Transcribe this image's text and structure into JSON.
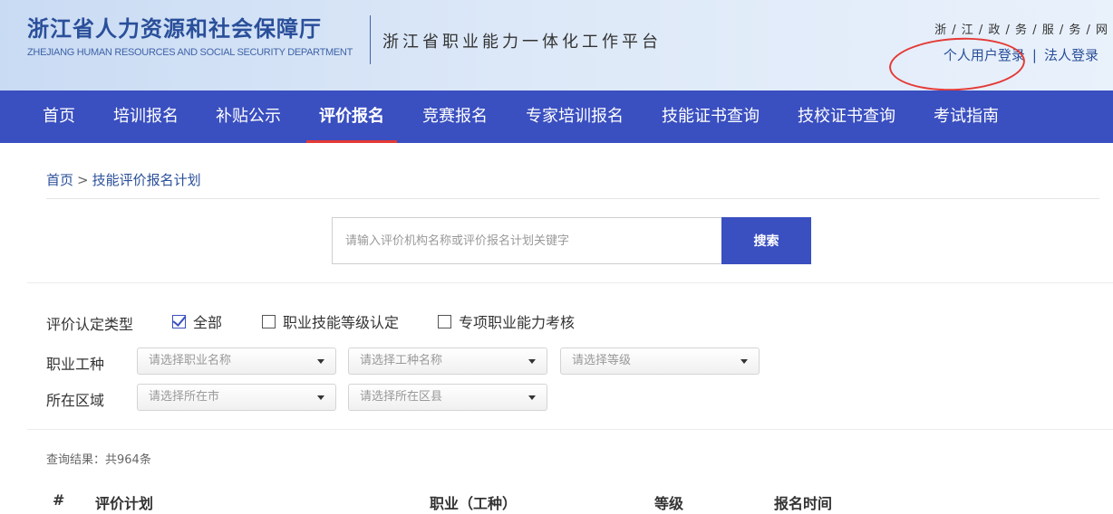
{
  "header": {
    "logo_cn": "浙江省人力资源和社会保障厅",
    "logo_en": "ZHEJIANG HUMAN RESOURCES AND SOCIAL SECURITY DEPARTMENT",
    "platform_name": "浙江省职业能力一体化工作平台",
    "gov_links": "浙 / 江 / 政 / 务 / 服 / 务 / 网",
    "personal_login": "个人用户登录",
    "separator": "|",
    "legal_login": "法人登录"
  },
  "nav": {
    "items": [
      "首页",
      "培训报名",
      "补贴公示",
      "评价报名",
      "竞赛报名",
      "专家培训报名",
      "技能证书查询",
      "技校证书查询",
      "考试指南"
    ],
    "active_index": 3
  },
  "breadcrumb": {
    "home": "首页",
    "sep": ">",
    "current": "技能评价报名计划"
  },
  "search": {
    "placeholder": "请输入评价机构名称或评价报名计划关键字",
    "button": "搜索"
  },
  "filters": {
    "type_label": "评价认定类型",
    "types": [
      {
        "label": "全部",
        "checked": true
      },
      {
        "label": "职业技能等级认定",
        "checked": false
      },
      {
        "label": "专项职业能力考核",
        "checked": false
      }
    ],
    "occupation_label": "职业工种",
    "occupation_selects": [
      "请选择职业名称",
      "请选择工种名称",
      "请选择等级"
    ],
    "region_label": "所在区域",
    "region_selects": [
      "请选择所在市",
      "请选择所在区县"
    ]
  },
  "results": {
    "count_text": "查询结果：共964条",
    "columns": [
      "#",
      "评价计划",
      "职业（工种）",
      "等级",
      "报名时间"
    ]
  },
  "colors": {
    "primary": "#3a4fc0",
    "brand_text": "#2a4f9a",
    "highlight": "#e53935"
  }
}
